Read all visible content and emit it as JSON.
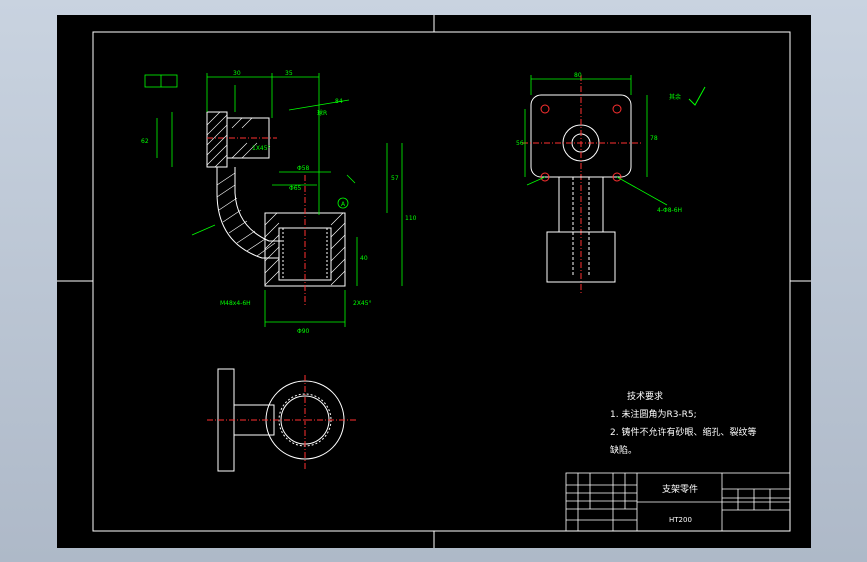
{
  "drawing": {
    "title_block": {
      "part_name": "支架零件",
      "material": "HT200"
    },
    "tech_requirements": {
      "heading": "技术要求",
      "line1": "1.  未注圆角为R3-R5;",
      "line2": "2.  铸件不允许有砂眼、缩孔、裂纹等",
      "line3": "缺陷。"
    },
    "annotations": {
      "rest": "其余",
      "spherical_radius": "球R",
      "thread_bottom": "M48x4-6H",
      "chamfer_top": "1X45°",
      "chamfer_bottom": "2X45°",
      "holes": "4-Φ8-6H",
      "datum_A": "A"
    },
    "dims": {
      "d30": "30",
      "d35": "35",
      "d84": "84",
      "d62": "62",
      "d57": "57",
      "d110": "110",
      "d40": "40",
      "d99": "Φ90",
      "d58": "Φ58",
      "d65": "Φ65",
      "d56": "56",
      "d80": "80",
      "d78": "78"
    },
    "colors": {
      "background": "#000000",
      "line": "#ffffff",
      "dimension": "#00ff00",
      "center": "#ff3030",
      "section": "#ffffff"
    }
  }
}
